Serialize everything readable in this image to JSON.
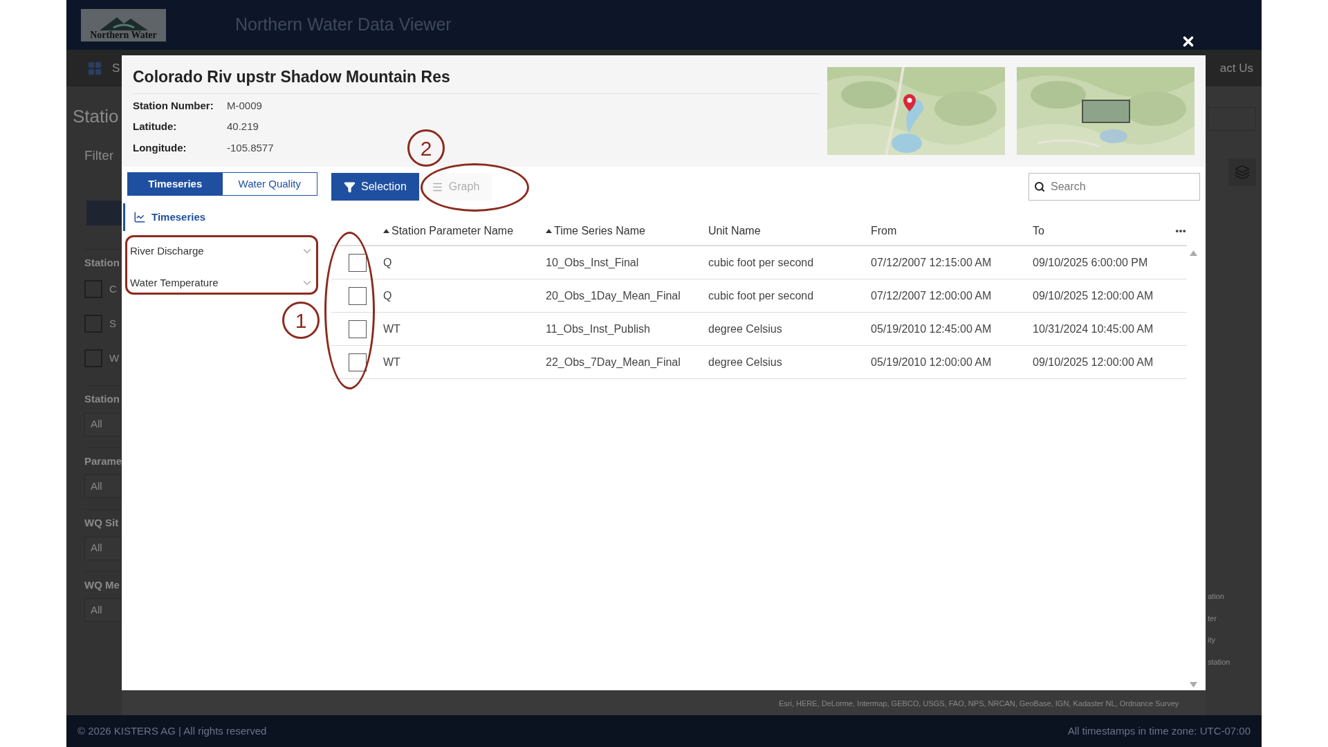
{
  "app": {
    "logo_text": "Northern Water",
    "title": "Northern Water Data Viewer",
    "nav_fragment_left": "S",
    "nav_fragment_right": "act Us"
  },
  "background_panel": {
    "heading": "Statio",
    "filter_label": "Filter",
    "groups": [
      {
        "label": "Station",
        "kind": "checks",
        "checks": [
          {
            "label": "C",
            "checked": false
          },
          {
            "label": "S",
            "checked": false
          },
          {
            "label": "W",
            "checked": false
          }
        ]
      },
      {
        "label": "Station",
        "kind": "select",
        "value": "All"
      },
      {
        "label": "Parame",
        "kind": "select",
        "value": "All"
      },
      {
        "label": "WQ Sit",
        "kind": "select",
        "value": "All"
      },
      {
        "label": "WQ Me",
        "kind": "select",
        "value": "All"
      }
    ]
  },
  "map_legend": [
    "ation",
    "ter",
    "ity",
    "station"
  ],
  "map_attribution": "Esri, HERE, DeLorme, Intermap, GEBCO, USGS, FAO, NPS, NRCAN, GeoBase, IGN, Kadaster NL, Ordnance Survey",
  "dialog": {
    "title": "Colorado Riv upstr Shadow Mountain Res",
    "info": [
      {
        "label": "Station Number:",
        "value": "M-0009"
      },
      {
        "label": "Latitude:",
        "value": "40.219"
      },
      {
        "label": "Longitude:",
        "value": "-105.8577"
      }
    ],
    "tabs": [
      {
        "label": "Timeseries",
        "selected": true
      },
      {
        "label": "Water Quality",
        "selected": false
      }
    ],
    "side_items": [
      {
        "label": "Timeseries",
        "selected": true
      }
    ],
    "parameters": [
      "River Discharge",
      "Water Temperature"
    ],
    "toolbar": [
      {
        "label": "Selection",
        "kind": "filter",
        "selected": true,
        "disabled": false
      },
      {
        "label": "Graph",
        "kind": "menu",
        "selected": false,
        "disabled": true
      }
    ],
    "search": {
      "placeholder": "Search"
    },
    "table": {
      "columns": [
        {
          "label": "Station Parameter Name",
          "sorted": true
        },
        {
          "label": "Time Series Name",
          "sorted": true
        },
        {
          "label": "Unit Name",
          "sorted": false
        },
        {
          "label": "From",
          "sorted": false
        },
        {
          "label": "To",
          "sorted": false
        }
      ],
      "rows": [
        {
          "checked": false,
          "cells": [
            "Q",
            "10_Obs_Inst_Final",
            "cubic foot per second",
            "07/12/2007 12:15:00 AM",
            "09/10/2025 6:00:00 PM"
          ]
        },
        {
          "checked": false,
          "cells": [
            "Q",
            "20_Obs_1Day_Mean_Final",
            "cubic foot per second",
            "07/12/2007 12:00:00 AM",
            "09/10/2025 12:00:00 AM"
          ]
        },
        {
          "checked": false,
          "cells": [
            "WT",
            "11_Obs_Inst_Publish",
            "degree Celsius",
            "05/19/2010 12:45:00 AM",
            "10/31/2024 10:45:00 AM"
          ]
        },
        {
          "checked": false,
          "cells": [
            "WT",
            "22_Obs_7Day_Mean_Final",
            "degree Celsius",
            "05/19/2010 12:00:00 AM",
            "09/10/2025 12:00:00 AM"
          ]
        }
      ]
    },
    "annotations": [
      {
        "label": "1",
        "kind": "parameters"
      },
      {
        "label": "2",
        "kind": "graph"
      }
    ]
  },
  "footer": {
    "left": "© 2026 KISTERS AG | All rights reserved",
    "right": "All timestamps in time zone: UTC-07:00"
  }
}
